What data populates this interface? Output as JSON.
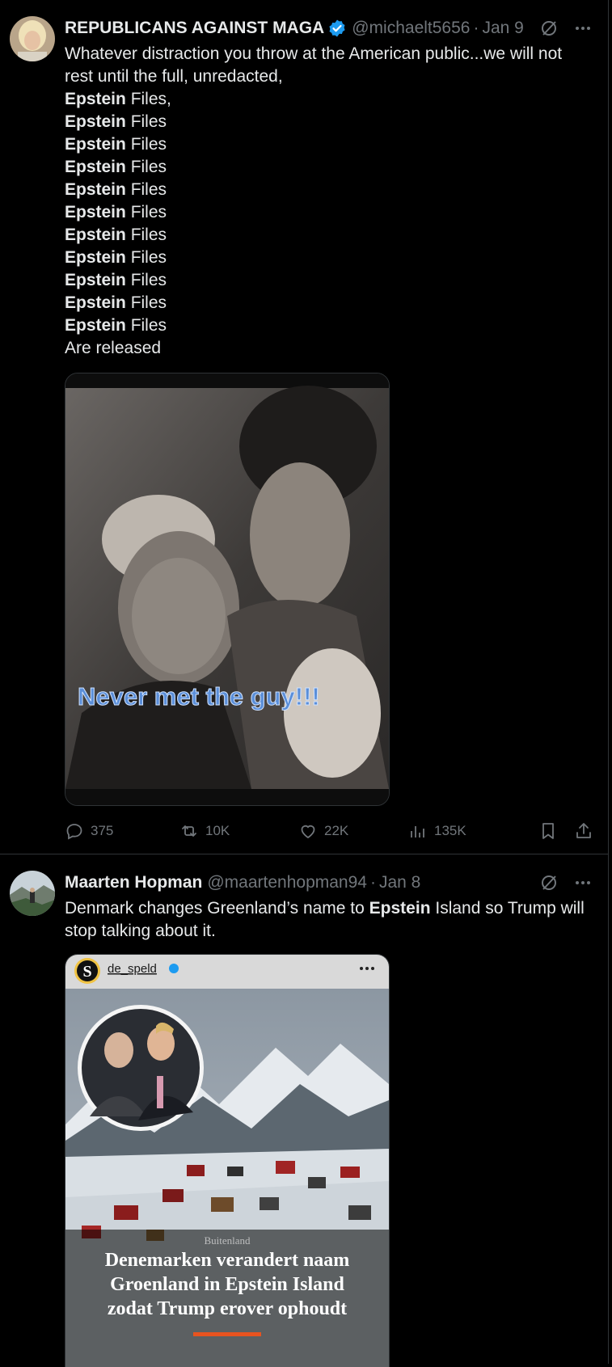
{
  "tweets": [
    {
      "name": "REPUBLICANS AGAINST MAGA",
      "handle": "@michaelt5656",
      "dot": "·",
      "date": "Jan 9",
      "text_intro": "Whatever distraction you throw at the American public...we will not rest until the full, unredacted,",
      "lines": [
        {
          "bold": "Epstein",
          "rest": " Files,"
        },
        {
          "bold": "Epstein",
          "rest": " Files"
        },
        {
          "bold": "Epstein",
          "rest": " Files"
        },
        {
          "bold": "Epstein",
          "rest": " Files"
        },
        {
          "bold": "Epstein",
          "rest": " Files"
        },
        {
          "bold": "Epstein",
          "rest": " Files"
        },
        {
          "bold": "Epstein",
          "rest": " Files"
        },
        {
          "bold": "Epstein",
          "rest": " Files"
        },
        {
          "bold": "Epstein",
          "rest": " Files"
        },
        {
          "bold": "Epstein",
          "rest": " Files"
        },
        {
          "bold": "Epstein",
          "rest": " Files"
        }
      ],
      "text_outro": "Are released",
      "media_caption": "Never met the guy!!!",
      "stats": {
        "replies": "375",
        "reposts": "10K",
        "likes": "22K",
        "views": "135K"
      }
    },
    {
      "name": "Maarten Hopman",
      "handle": "@maartenhopman94",
      "dot": "·",
      "date": "Jan 8",
      "text_pre": "Denmark changes Greenland’s name to ",
      "text_bold": "Epstein",
      "text_post": " Island so Trump will stop talking about it.",
      "media": {
        "account": "de_speld",
        "account_initial": "S",
        "section_label": "Buitenland",
        "headline_1": "Denemarken verandert naam",
        "headline_2": "Groenland in Epstein Island",
        "headline_3": "zodat Trump erover ophoudt",
        "accent_color": "#e8531f"
      }
    }
  ],
  "colors": {
    "background": "#000000",
    "text": "#e7e9ea",
    "muted": "#71767b",
    "verified": "#1d9bf0"
  }
}
